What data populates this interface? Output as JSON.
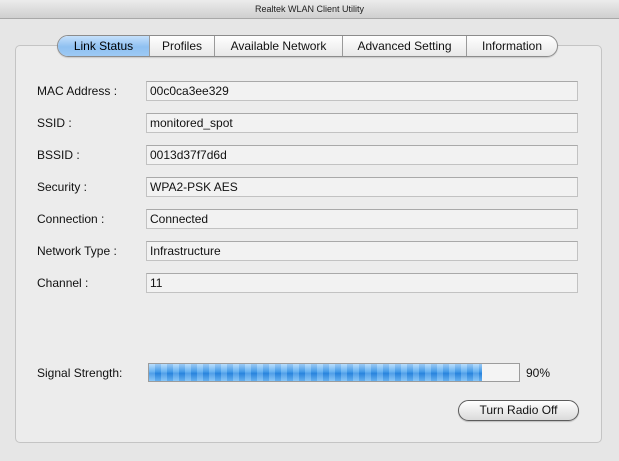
{
  "window": {
    "title": "Realtek WLAN Client Utility"
  },
  "tabs": [
    {
      "label": "Link Status",
      "active": true
    },
    {
      "label": "Profiles",
      "active": false
    },
    {
      "label": "Available Network",
      "active": false
    },
    {
      "label": "Advanced Setting",
      "active": false
    },
    {
      "label": "Information",
      "active": false
    }
  ],
  "fields": {
    "mac": {
      "label": "MAC Address :",
      "value": "00c0ca3ee329"
    },
    "ssid": {
      "label": "SSID :",
      "value": "monitored_spot"
    },
    "bssid": {
      "label": "BSSID :",
      "value": "0013d37f7d6d"
    },
    "security": {
      "label": "Security :",
      "value": "WPA2-PSK AES"
    },
    "connection": {
      "label": "Connection :",
      "value": "Connected"
    },
    "network_type": {
      "label": "Network Type :",
      "value": "Infrastructure"
    },
    "channel": {
      "label": "Channel :",
      "value": "11"
    }
  },
  "signal": {
    "label": "Signal Strength:",
    "percent_text": "90%",
    "level": 0.9
  },
  "actions": {
    "radio_label": "Turn Radio Off"
  },
  "colors": {
    "active_tab": "#8fc0f1",
    "signal_fill": "#2c8ae3"
  }
}
